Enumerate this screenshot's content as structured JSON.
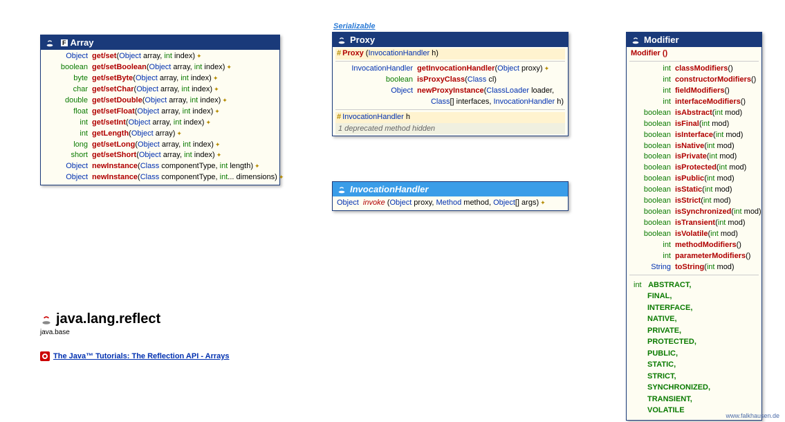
{
  "superlink": "Serializable",
  "array": {
    "title": "Array",
    "rows": [
      {
        "ret": "Object",
        "retClass": "typ",
        "name": "get/set",
        "args": "(Object array, int index)",
        "star": true
      },
      {
        "ret": "boolean",
        "retClass": "prim",
        "name": "get/setBoolean",
        "args": "(Object array, int index)",
        "star": true
      },
      {
        "ret": "byte",
        "retClass": "prim",
        "name": "get/setByte",
        "args": "(Object array, int index)",
        "star": true
      },
      {
        "ret": "char",
        "retClass": "prim",
        "name": "get/setChar",
        "args": "(Object array, int index)",
        "star": true
      },
      {
        "ret": "double",
        "retClass": "prim",
        "name": "get/setDouble",
        "args": "(Object array, int index)",
        "star": true
      },
      {
        "ret": "float",
        "retClass": "prim",
        "name": "get/setFloat",
        "args": "(Object array, int index)",
        "star": true
      },
      {
        "ret": "int",
        "retClass": "prim",
        "name": "get/setInt",
        "args": "(Object array, int index)",
        "star": true
      },
      {
        "ret": "int",
        "retClass": "prim",
        "name": "getLength",
        "args": "(Object array)",
        "star": true
      },
      {
        "ret": "long",
        "retClass": "prim",
        "name": "get/setLong",
        "args": "(Object array, int index)",
        "star": true
      },
      {
        "ret": "short",
        "retClass": "prim",
        "name": "get/setShort",
        "args": "(Object array, int index)",
        "star": true
      },
      {
        "ret": "Object",
        "retClass": "typ",
        "name": "newInstance",
        "args": "(Class<?> componentType, int length)",
        "star": true
      },
      {
        "ret": "Object",
        "retClass": "typ",
        "name": "newInstance",
        "args": "(Class<?> componentType, int... dimensions)",
        "star": true
      }
    ]
  },
  "proxy": {
    "title": "Proxy",
    "ctor": {
      "name": "Proxy",
      "args": "(InvocationHandler h)"
    },
    "rows": [
      {
        "ret": "InvocationHandler",
        "retClass": "typ",
        "name": "getInvocationHandler",
        "args": "(Object proxy)",
        "star": true
      },
      {
        "ret": "boolean",
        "retClass": "prim",
        "name": "isProxyClass",
        "args": "(Class<?> cl)"
      },
      {
        "ret": "Object",
        "retClass": "typ",
        "name": "newProxyInstance",
        "args": "(ClassLoader loader,",
        "args2": "Class<?>[] interfaces, InvocationHandler h)"
      }
    ],
    "field": {
      "type": "InvocationHandler",
      "name": "h"
    },
    "deprecated": "1 deprecated method hidden"
  },
  "invoc": {
    "title": "InvocationHandler",
    "row": {
      "ret": "Object",
      "name": "invoke",
      "args": "(Object proxy, Method method, Object[] args)",
      "star": true
    }
  },
  "modifier": {
    "title": "Modifier",
    "ctor": "Modifier ()",
    "rows": [
      {
        "ret": "int",
        "retClass": "prim",
        "name": "classModifiers",
        "args": "()"
      },
      {
        "ret": "int",
        "retClass": "prim",
        "name": "constructorModifiers",
        "args": "()"
      },
      {
        "ret": "int",
        "retClass": "prim",
        "name": "fieldModifiers",
        "args": "()"
      },
      {
        "ret": "int",
        "retClass": "prim",
        "name": "interfaceModifiers",
        "args": "()"
      },
      {
        "ret": "boolean",
        "retClass": "prim",
        "name": "isAbstract",
        "args": "(int mod)"
      },
      {
        "ret": "boolean",
        "retClass": "prim",
        "name": "isFinal",
        "args": "(int mod)"
      },
      {
        "ret": "boolean",
        "retClass": "prim",
        "name": "isInterface",
        "args": "(int mod)"
      },
      {
        "ret": "boolean",
        "retClass": "prim",
        "name": "isNative",
        "args": "(int mod)"
      },
      {
        "ret": "boolean",
        "retClass": "prim",
        "name": "isPrivate",
        "args": "(int mod)"
      },
      {
        "ret": "boolean",
        "retClass": "prim",
        "name": "isProtected",
        "args": "(int mod)"
      },
      {
        "ret": "boolean",
        "retClass": "prim",
        "name": "isPublic",
        "args": "(int mod)"
      },
      {
        "ret": "boolean",
        "retClass": "prim",
        "name": "isStatic",
        "args": "(int mod)"
      },
      {
        "ret": "boolean",
        "retClass": "prim",
        "name": "isStrict",
        "args": "(int mod)"
      },
      {
        "ret": "boolean",
        "retClass": "prim",
        "name": "isSynchronized",
        "args": "(int mod)"
      },
      {
        "ret": "boolean",
        "retClass": "prim",
        "name": "isTransient",
        "args": "(int mod)"
      },
      {
        "ret": "boolean",
        "retClass": "prim",
        "name": "isVolatile",
        "args": "(int mod)"
      },
      {
        "ret": "int",
        "retClass": "prim",
        "name": "methodModifiers",
        "args": "()"
      },
      {
        "ret": "int",
        "retClass": "prim",
        "name": "parameterModifiers",
        "args": "()"
      },
      {
        "ret": "String",
        "retClass": "typ",
        "name": "toString",
        "args": "(int mod)"
      }
    ],
    "constants": [
      "ABSTRACT,",
      "FINAL,",
      "INTERFACE,",
      "NATIVE,",
      "PRIVATE,",
      "PROTECTED,",
      "PUBLIC,",
      "STATIC,",
      "STRICT,",
      "SYNCHRONIZED,",
      "TRANSIENT,",
      "VOLATILE"
    ],
    "constRet": "int"
  },
  "pkg": {
    "name": "java.lang.reflect",
    "module": "java.base"
  },
  "tutorial": "The Java™ Tutorials: The Reflection API - Arrays",
  "footer": "www.falkhausen.de"
}
